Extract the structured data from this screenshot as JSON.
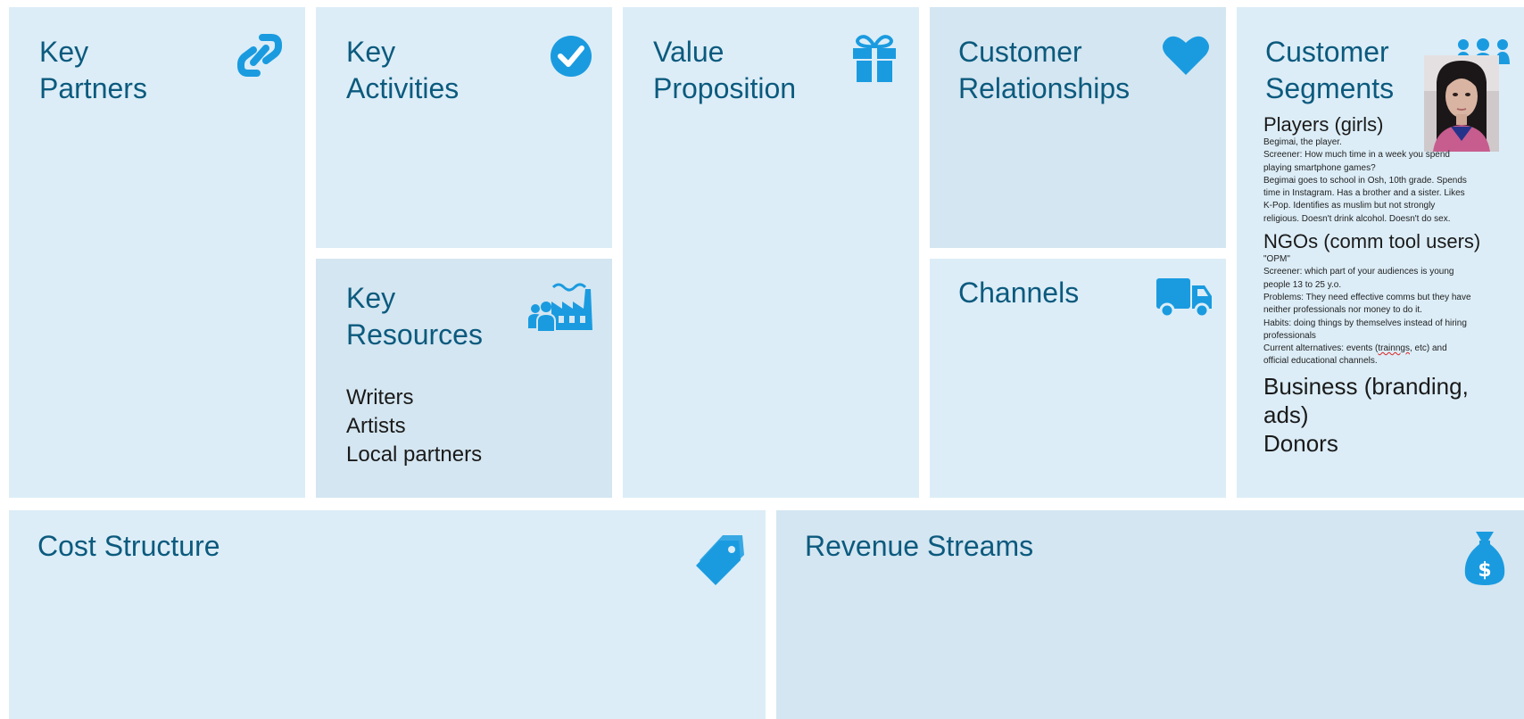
{
  "colors": {
    "accent": "#1a9be0",
    "title": "#0c5a7e",
    "panel": "#dcedf7"
  },
  "key_partners": {
    "title_line1": "Key",
    "title_line2": "Partners",
    "icon": "link-icon"
  },
  "key_activities": {
    "title_line1": "Key",
    "title_line2": "Activities",
    "icon": "check-circle-icon"
  },
  "key_resources": {
    "title_line1": "Key",
    "title_line2": "Resources",
    "icon": "factory-people-icon",
    "items": [
      "Writers",
      "Artists",
      "Local partners"
    ]
  },
  "value_proposition": {
    "title_line1": "Value",
    "title_line2": "Proposition",
    "icon": "gift-icon"
  },
  "customer_relationships": {
    "title_line1": "Customer",
    "title_line2": "Relationships",
    "icon": "heart-icon"
  },
  "channels": {
    "title": "Channels",
    "icon": "truck-icon"
  },
  "customer_segments": {
    "title_line1": "Customer",
    "title_line2": "Segments",
    "icon": "people-group-icon",
    "photo": "player-photo",
    "players_heading": "Players (girls)",
    "players_lines": [
      "Begimai, the player.",
      "Screener: How much time in a week you spend",
      "playing smartphone games?",
      "Begimai goes to school in Osh, 10th grade. Spends",
      "time in Instagram. Has a brother and a sister. Likes",
      "K-Pop. Identifies as muslim but not strongly",
      "religious. Doesn't drink alcohol. Doesn't do sex."
    ],
    "ngos_heading": "NGOs (comm tool users)",
    "ngos_lines": [
      "\"OPM\"",
      "Screener: which part of your audiences is young",
      "people 13 to 25 y.o.",
      "Problems: They need effective comms but they have",
      "neither professionals nor money to do it.",
      "Habits: doing things by themselves instead of hiring",
      "professionals"
    ],
    "ngos_alt_prefix": "Current alternatives: events (",
    "ngos_alt_squiggle": "trainngs",
    "ngos_alt_suffix": ", etc) and",
    "ngos_alt_last": "official educational channels.",
    "business_line1": "Business (branding,",
    "business_line2": "ads)",
    "donors": "Donors"
  },
  "cost_structure": {
    "title": "Cost Structure",
    "icon": "tags-icon"
  },
  "revenue_streams": {
    "title": "Revenue Streams",
    "icon": "money-bag-icon"
  }
}
